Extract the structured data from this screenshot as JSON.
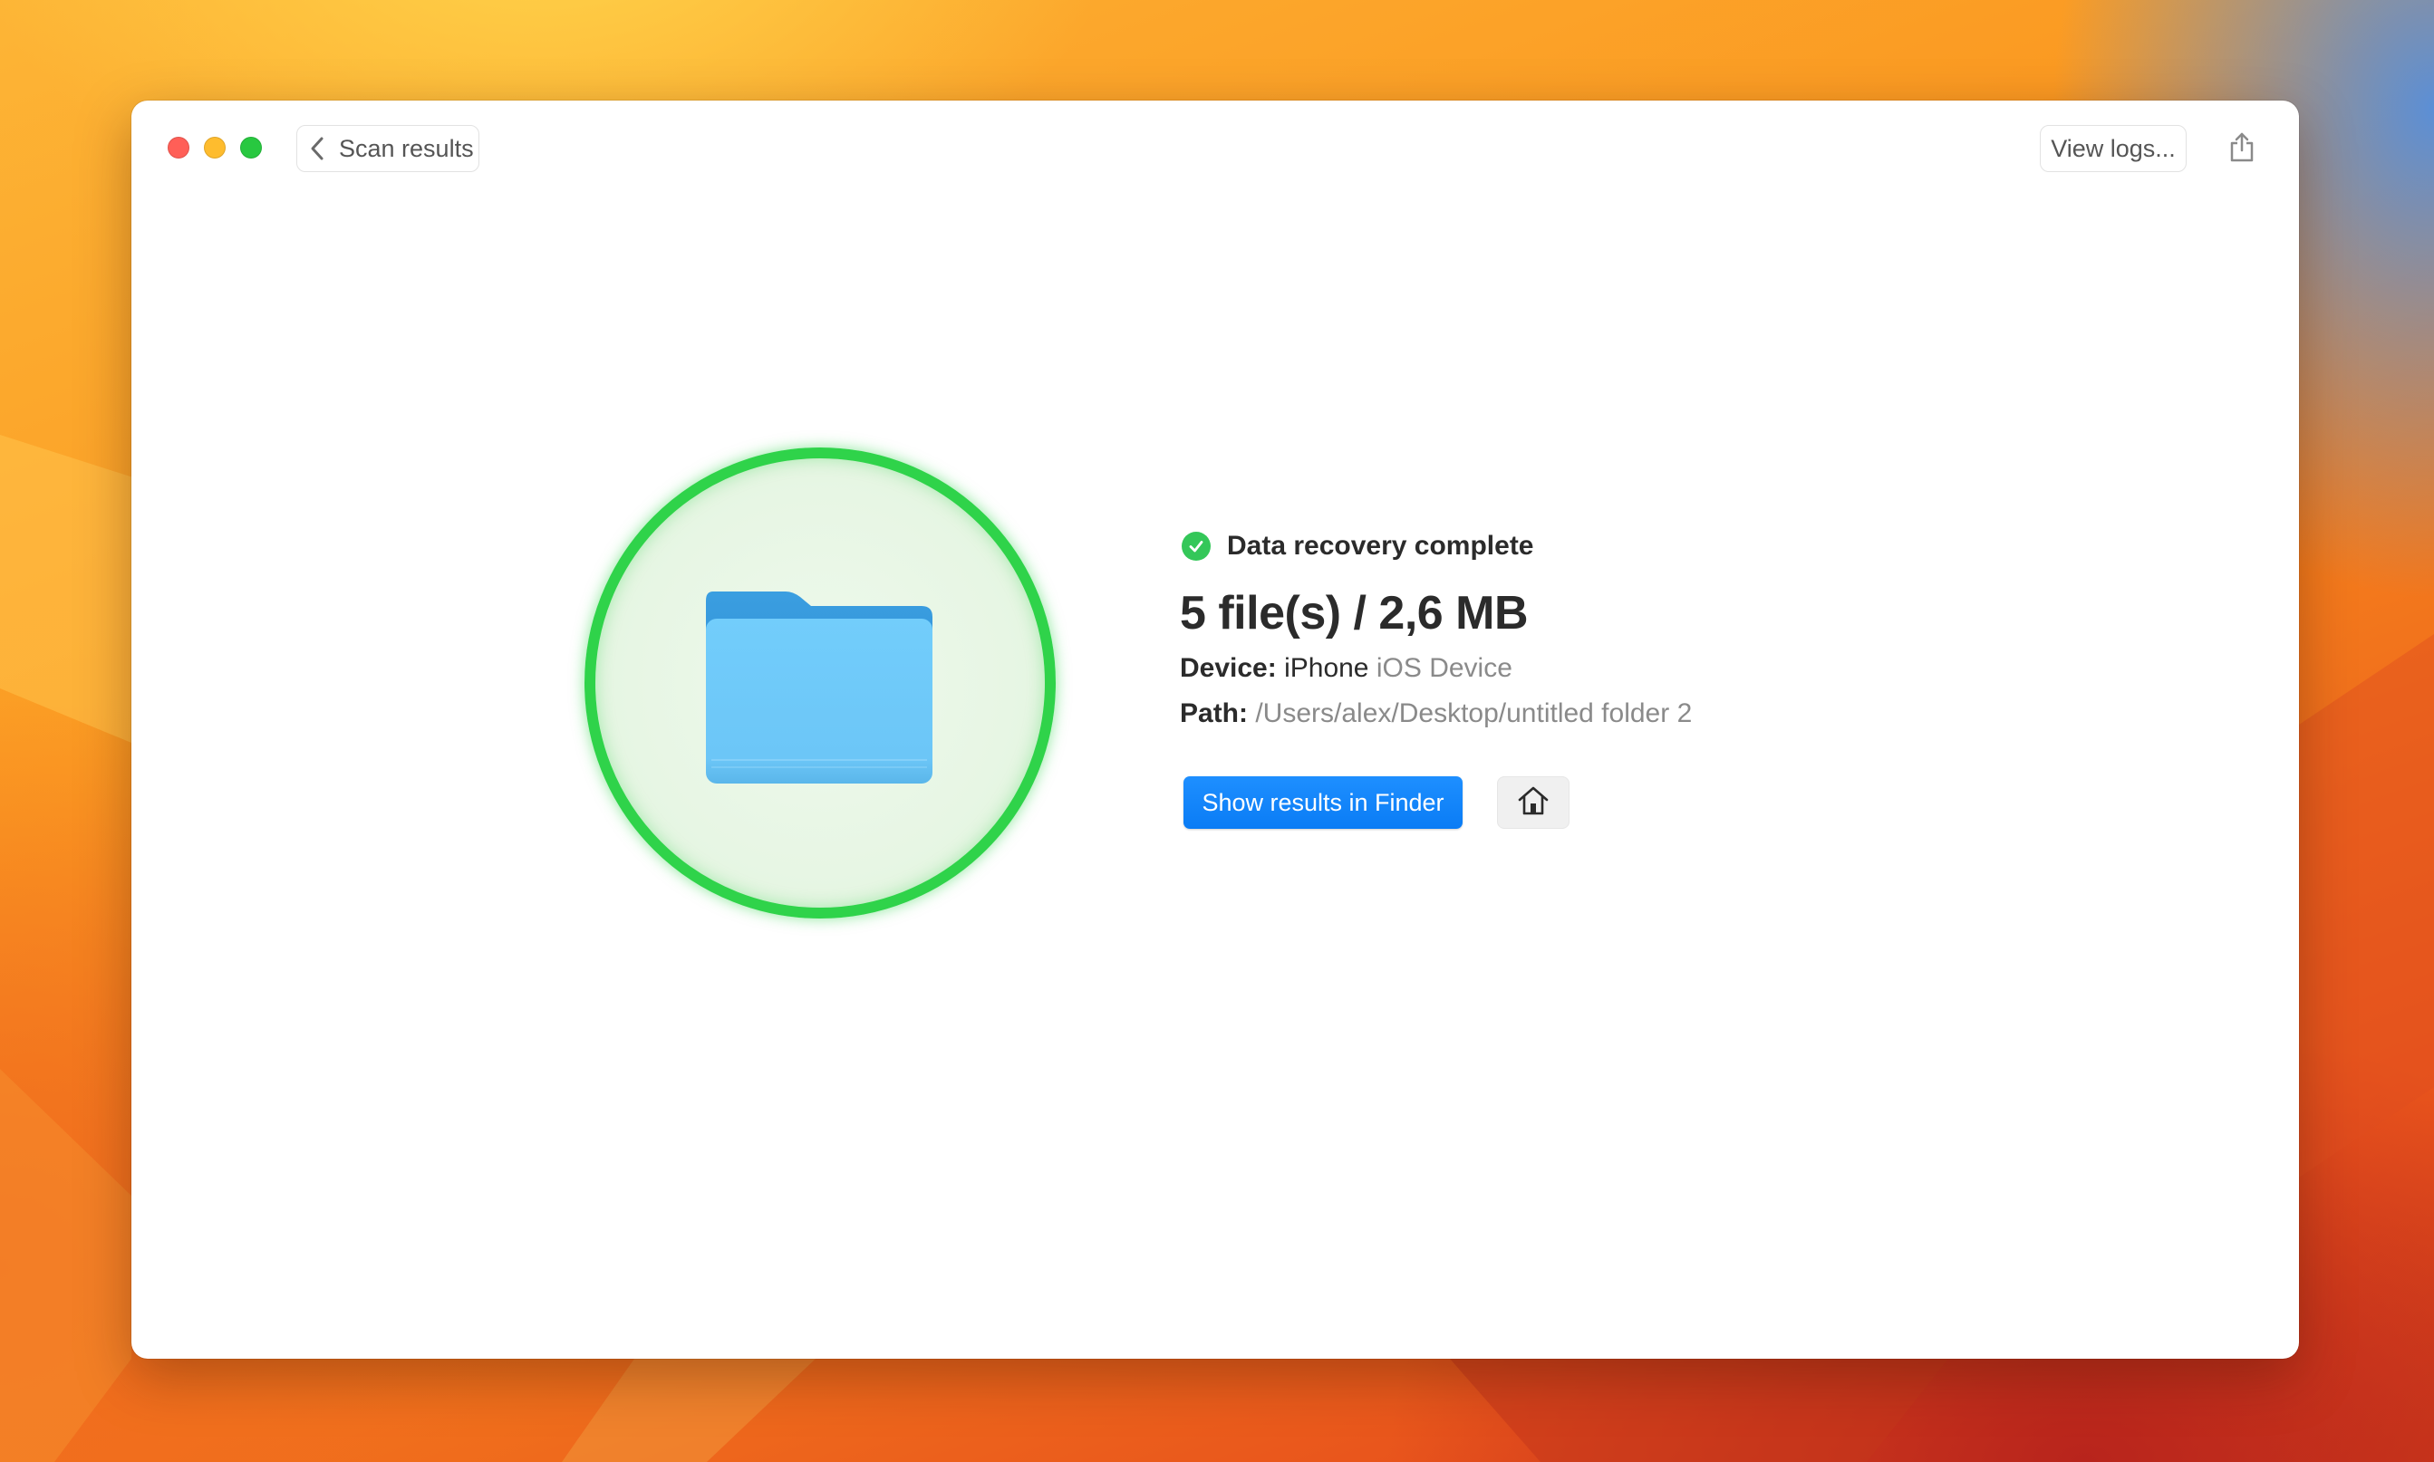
{
  "toolbar": {
    "back_label": "Scan results",
    "view_logs_label": "View logs..."
  },
  "result": {
    "status": "Data recovery complete",
    "summary": "5 file(s) / 2,6 MB",
    "device_label": "Device:",
    "device_name": "iPhone",
    "device_type": "iOS Device",
    "path_label": "Path:",
    "path_value": "/Users/alex/Desktop/untitled folder 2"
  },
  "actions": {
    "show_in_finder_label": "Show results in Finder"
  },
  "icons": {
    "back": "chevron-left-icon",
    "share": "share-icon",
    "status": "checkmark-circle-icon",
    "folder": "folder-icon",
    "home": "house-icon"
  },
  "colors": {
    "accent": "#0a84ff",
    "success": "#34c759",
    "ring": "#2fd34a",
    "folder": "#6cc6f7"
  }
}
